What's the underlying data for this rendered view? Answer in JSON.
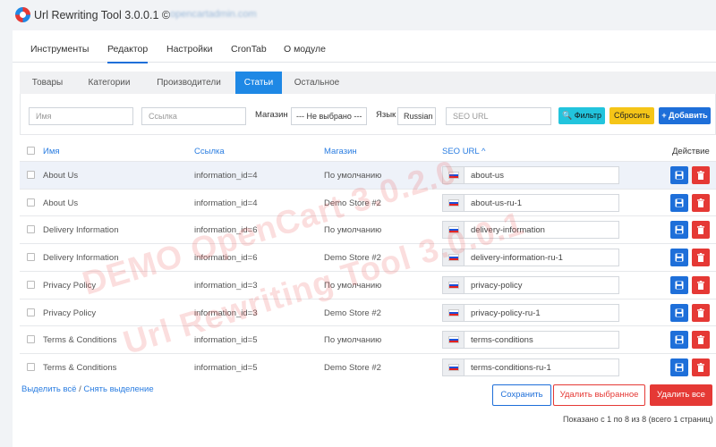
{
  "app": {
    "title": "Url Rewriting Tool 3.0.0.1 ©",
    "url": "opencartadmin.com"
  },
  "main_tabs": [
    "Инструменты",
    "Редактор",
    "Настройки",
    "CronTab",
    "О модуле"
  ],
  "sub_tabs": [
    "Товары",
    "Категории",
    "Производители",
    "Статьи",
    "Остальное"
  ],
  "filters": {
    "name_placeholder": "Имя",
    "link_placeholder": "Ссылка",
    "store_label": "Магазин",
    "store_value": "--- Не выбрано ---",
    "lang_label": "Язык",
    "lang_value": "Russian",
    "seo_placeholder": "SEO URL",
    "filter_btn": "Фильтр",
    "reset_btn": "Сбросить",
    "add_btn": "Добавить"
  },
  "table": {
    "headers": {
      "name": "Имя",
      "link": "Ссылка",
      "store": "Магазин",
      "seo": "SEO URL ^",
      "action": "Действие"
    },
    "rows": [
      {
        "name": "About Us",
        "link": "information_id=4",
        "store": "По умолчанию",
        "seo": "about-us"
      },
      {
        "name": "About Us",
        "link": "information_id=4",
        "store": "Demo Store #2",
        "seo": "about-us-ru-1"
      },
      {
        "name": "Delivery Information",
        "link": "information_id=6",
        "store": "По умолчанию",
        "seo": "delivery-information"
      },
      {
        "name": "Delivery Information",
        "link": "information_id=6",
        "store": "Demo Store #2",
        "seo": "delivery-information-ru-1"
      },
      {
        "name": "Privacy Policy",
        "link": "information_id=3",
        "store": "По умолчанию",
        "seo": "privacy-policy"
      },
      {
        "name": "Privacy Policy",
        "link": "information_id=3",
        "store": "Demo Store #2",
        "seo": "privacy-policy-ru-1"
      },
      {
        "name": "Terms & Conditions",
        "link": "information_id=5",
        "store": "По умолчанию",
        "seo": "terms-conditions"
      },
      {
        "name": "Terms & Conditions",
        "link": "information_id=5",
        "store": "Demo Store #2",
        "seo": "terms-conditions-ru-1"
      }
    ]
  },
  "footer": {
    "select_all": "Выделить всё",
    "separator": "/",
    "deselect": "Снять выделение",
    "save_btn": "Сохранить",
    "delete_selected_btn": "Удалить выбранное",
    "delete_all_btn": "Удалить все",
    "pagination": "Показано с 1 по 8 из 8 (всего 1 страниц)"
  },
  "watermark": [
    "DEMO OpenCart 3.0.2.0",
    "Url Rewriting Tool 3.0.0.1"
  ],
  "colors": {
    "primary": "#1e6fd9",
    "tab_active": "#1e88e5",
    "filter_btn": "#22c4dd",
    "reset_btn": "#f5c518",
    "danger": "#e53935",
    "link": "#2a7de1"
  }
}
